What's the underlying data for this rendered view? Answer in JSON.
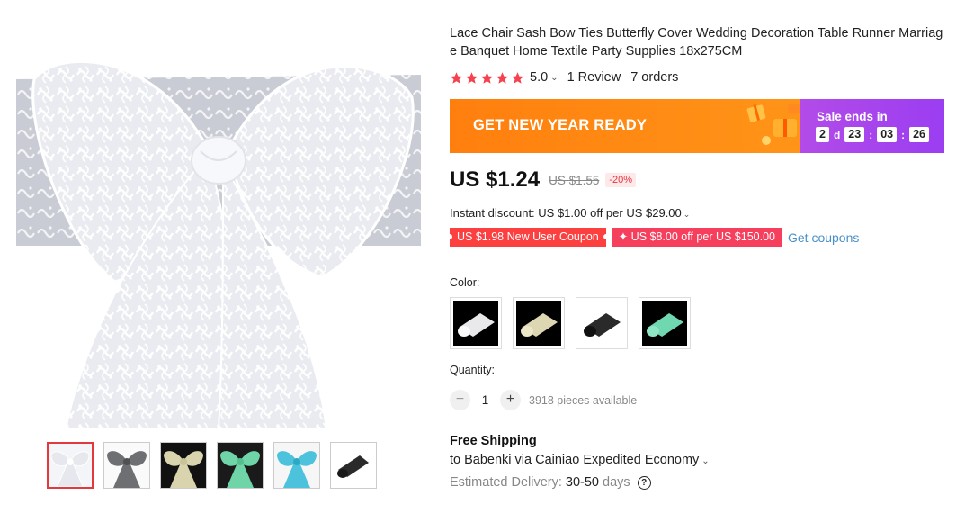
{
  "product": {
    "title": "Lace Chair Sash Bow Ties Butterfly Cover Wedding Decoration Table Runner Marriage Banquet Home Textile Party Supplies 18x275CM",
    "rating_value": "5.0",
    "rating_stars": 5,
    "reviews": "1 Review",
    "orders": "7 orders"
  },
  "gallery": {
    "main_image_icon": "lace-chair-sash-bow-image",
    "thumbnails": [
      {
        "icon": "white-lace-bow-thumb",
        "active": true
      },
      {
        "icon": "gray-lace-bow-thumb",
        "active": false
      },
      {
        "icon": "ivory-lace-bow-thumb",
        "active": false
      },
      {
        "icon": "mint-lace-bow-thumb",
        "active": false
      },
      {
        "icon": "turquoise-lace-bow-thumb",
        "active": false
      },
      {
        "icon": "black-lace-roll-thumb",
        "active": false
      }
    ]
  },
  "banner": {
    "promo_text": "GET NEW YEAR READY",
    "sale_label": "Sale ends in",
    "days": "2",
    "days_unit": "d",
    "hours": "23",
    "minutes": "03",
    "seconds": "26",
    "colors": {
      "left": "#ff7f0e",
      "right": "#a044ee"
    }
  },
  "price": {
    "current": "US $1.24",
    "original": "US $1.55",
    "discount": "-20%"
  },
  "instant_discount": "Instant discount: US $1.00 off per US $29.00",
  "coupons": {
    "new_user": "US $1.98 New User Coupon",
    "store": "✦ US $8.00 off per US $150.00",
    "get_link": "Get coupons"
  },
  "color": {
    "label": "Color:",
    "options": [
      {
        "icon": "white-lace-roll-swatch"
      },
      {
        "icon": "ivory-lace-roll-swatch"
      },
      {
        "icon": "black-lace-roll-swatch"
      },
      {
        "icon": "mint-lace-roll-swatch"
      }
    ]
  },
  "quantity": {
    "label": "Quantity:",
    "value": "1",
    "minus": "−",
    "plus": "+",
    "available": "3918 pieces available"
  },
  "shipping": {
    "title": "Free Shipping",
    "to": "to Babenki via Cainiao Expedited Economy",
    "delivery_label": "Estimated Delivery:",
    "delivery_value": "30-50",
    "delivery_unit": "days",
    "help_icon": "?"
  },
  "accent_colors": {
    "star": "#f5424e",
    "coupon": "#fc3f3f",
    "link": "#4a90c8"
  }
}
